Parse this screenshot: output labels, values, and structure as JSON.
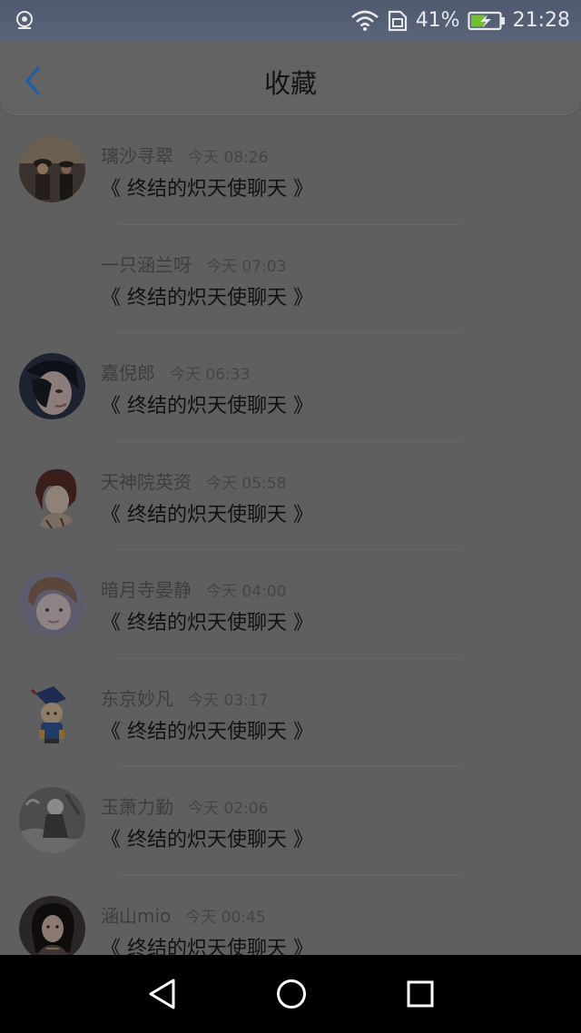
{
  "status_bar": {
    "battery_percent": "41%",
    "time": "21:28",
    "icons": [
      "notification-icon",
      "wifi-icon",
      "sim-icon",
      "battery-charging-icon"
    ]
  },
  "header": {
    "title": "收藏",
    "back_icon": "chevron-left-icon"
  },
  "favorites": [
    {
      "name": "璃沙寻翠",
      "time": "今天 08:26",
      "message": "《 终结的炽天使聊天 》",
      "has_avatar": true
    },
    {
      "name": "一只涵兰呀",
      "time": "今天 07:03",
      "message": "《 终结的炽天使聊天 》",
      "has_avatar": false
    },
    {
      "name": "嘉倪郎",
      "time": "今天 06:33",
      "message": "《 终结的炽天使聊天 》",
      "has_avatar": true
    },
    {
      "name": "天神院英资",
      "time": "今天 05:58",
      "message": "《 终结的炽天使聊天 》",
      "has_avatar": true
    },
    {
      "name": "暗月寺晏静",
      "time": "今天 04:00",
      "message": "《 终结的炽天使聊天 》",
      "has_avatar": true
    },
    {
      "name": "东京妙凡",
      "time": "今天 03:17",
      "message": "《 终结的炽天使聊天 》",
      "has_avatar": true
    },
    {
      "name": "玉萧力勤",
      "time": "今天 02:06",
      "message": "《 终结的炽天使聊天 》",
      "has_avatar": true
    },
    {
      "name": "涵山mio",
      "time": "今天 00:45",
      "message": "《 终结的炽天使聊天 》",
      "has_avatar": true
    }
  ],
  "nav_bar": {
    "icons": [
      "back-triangle-icon",
      "home-circle-icon",
      "recents-square-icon"
    ]
  },
  "colors": {
    "overlay_background": "#5f5f5f",
    "status_bar": "#55607a",
    "back_arrow": "#1f5fa0"
  }
}
